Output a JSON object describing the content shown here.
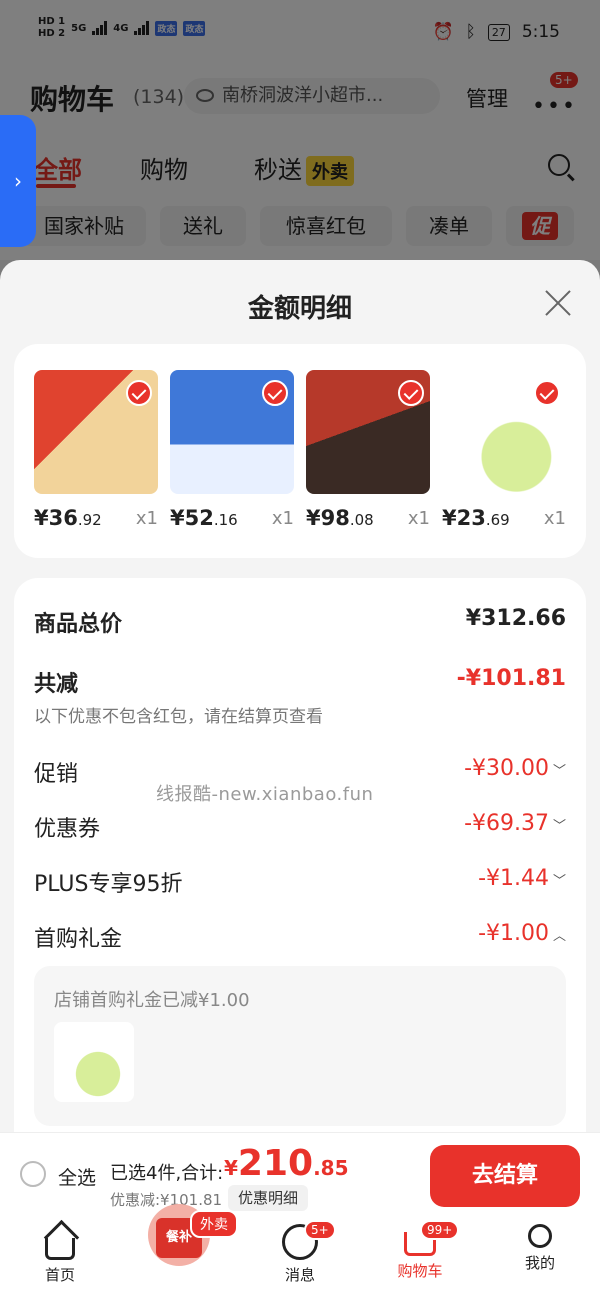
{
  "status_bar": {
    "hd1": "HD 1",
    "hd2": "HD 2",
    "net1": "5G",
    "net2": "4G",
    "tag1": "政态",
    "tag2": "政态",
    "battery": "27",
    "time": "5:15"
  },
  "header": {
    "title": "购物车",
    "count": "(134)",
    "store": "南桥洞波洋小超市...",
    "manage": "管理",
    "more_badge": "5+"
  },
  "tabs": [
    "全部",
    "购物",
    "秒送"
  ],
  "tab_tag": "外卖",
  "chips": [
    "国家补贴",
    "送礼",
    "惊喜红包",
    "凑单",
    "促"
  ],
  "sheet": {
    "title": "金额明细",
    "items": [
      {
        "price_int": "¥36",
        "price_dec": ".92",
        "qty": "x1",
        "color": "#e9b971"
      },
      {
        "price_int": "¥52",
        "price_dec": ".16",
        "qty": "x1",
        "color": "#3f78d8"
      },
      {
        "price_int": "¥98",
        "price_dec": ".08",
        "qty": "x1",
        "color": "#c8462c"
      },
      {
        "price_int": "¥23",
        "price_dec": ".69",
        "qty": "x1",
        "color": "#a8d46a"
      }
    ],
    "subtotal_label": "商品总价",
    "subtotal_value": "¥312.66",
    "reduce_label": "共减",
    "reduce_value": "-¥101.81",
    "reduce_note": "以下优惠不包含红包，请在结算页查看",
    "discounts": [
      {
        "label": "促销",
        "value": "-¥30.00"
      },
      {
        "label": "优惠券",
        "value": "-¥69.37"
      },
      {
        "label": "PLUS专享95折",
        "value": "-¥1.44"
      },
      {
        "label": "首购礼金",
        "value": "-¥1.00"
      }
    ],
    "gift_text": "店铺首购礼金已减¥1.00",
    "watermark": "线报酷-new.xianbao.fun"
  },
  "checkout": {
    "select_all": "全选",
    "total_label": "已选4件,合计:",
    "yen": "¥",
    "total_int": "210",
    "total_dec": ".85",
    "discount_text": "优惠减:¥101.81",
    "discount_btn": "优惠明细",
    "pay": "去结算"
  },
  "tabbar": {
    "items": [
      "首页",
      "",
      "消息",
      "购物车",
      "我的"
    ],
    "waimai_badge": "外卖",
    "mascot_label": "餐补",
    "msg_badge": "5+",
    "cart_badge": "99+"
  },
  "colors": {
    "accent": "#e8322b",
    "handle": "#2a6cf6"
  }
}
